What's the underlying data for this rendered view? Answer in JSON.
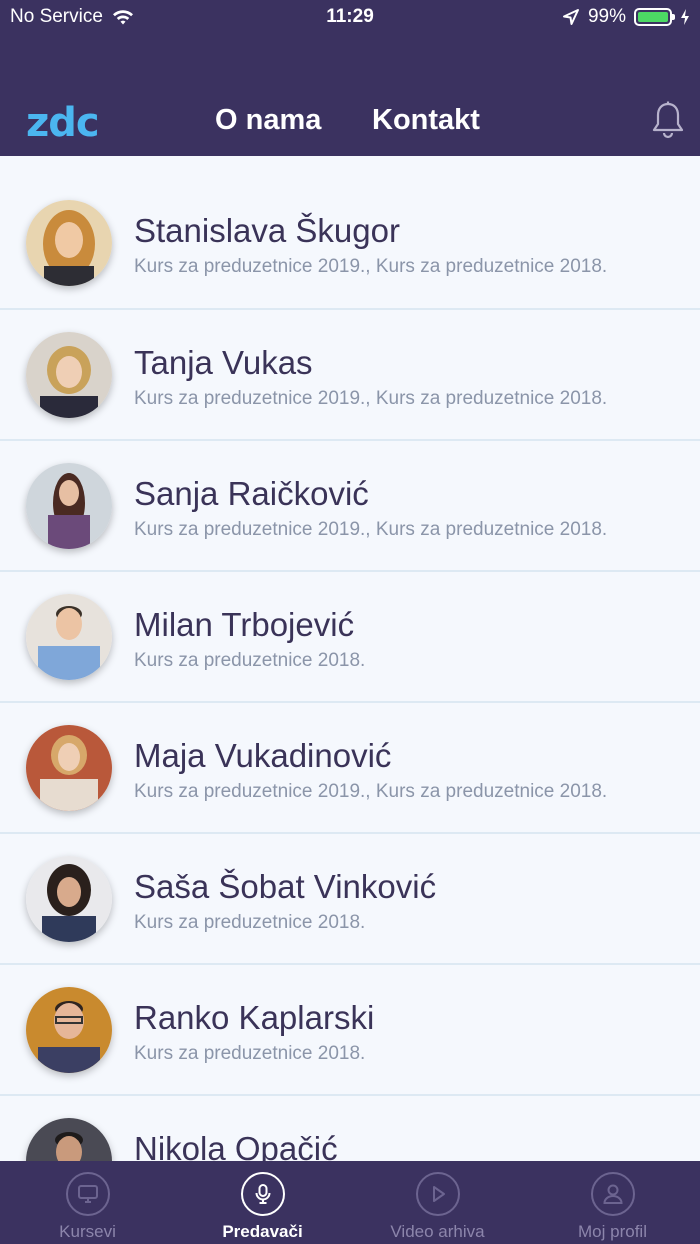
{
  "status_bar": {
    "carrier": "No Service",
    "time": "11:29",
    "battery": "99%",
    "battery_color": "#4cd964",
    "icons": [
      "wifi-icon",
      "location-arrow-icon",
      "battery-icon",
      "charging-bolt-icon"
    ]
  },
  "header": {
    "logo": "zdc",
    "links": [
      "O nama",
      "Kontakt"
    ],
    "bell_icon": "bell-icon",
    "background": "#3b3260",
    "logo_color": "#4bb6f0"
  },
  "speakers": [
    {
      "name": "Stanislava Škugor",
      "courses": "Kurs za preduzetnice 2019., Kurs za preduzetnice 2018."
    },
    {
      "name": "Tanja Vukas",
      "courses": "Kurs za preduzetnice 2019., Kurs za preduzetnice 2018."
    },
    {
      "name": "Sanja Raičković",
      "courses": "Kurs za preduzetnice 2019., Kurs za preduzetnice 2018."
    },
    {
      "name": "Milan Trbojević",
      "courses": "Kurs za preduzetnice 2018."
    },
    {
      "name": "Maja Vukadinović",
      "courses": "Kurs za preduzetnice 2019., Kurs za preduzetnice 2018."
    },
    {
      "name": "Saša Šobat Vinković",
      "courses": "Kurs za preduzetnice 2018."
    },
    {
      "name": "Ranko Kaplarski",
      "courses": "Kurs za preduzetnice 2018."
    },
    {
      "name": "Nikola Opačić",
      "courses": ""
    }
  ],
  "tabs": [
    {
      "label": "Kursevi",
      "icon": "monitor-icon",
      "active": false
    },
    {
      "label": "Predavači",
      "icon": "microphone-icon",
      "active": true
    },
    {
      "label": "Video arhiva",
      "icon": "play-icon",
      "active": false
    },
    {
      "label": "Moj profil",
      "icon": "user-icon",
      "active": false
    }
  ]
}
